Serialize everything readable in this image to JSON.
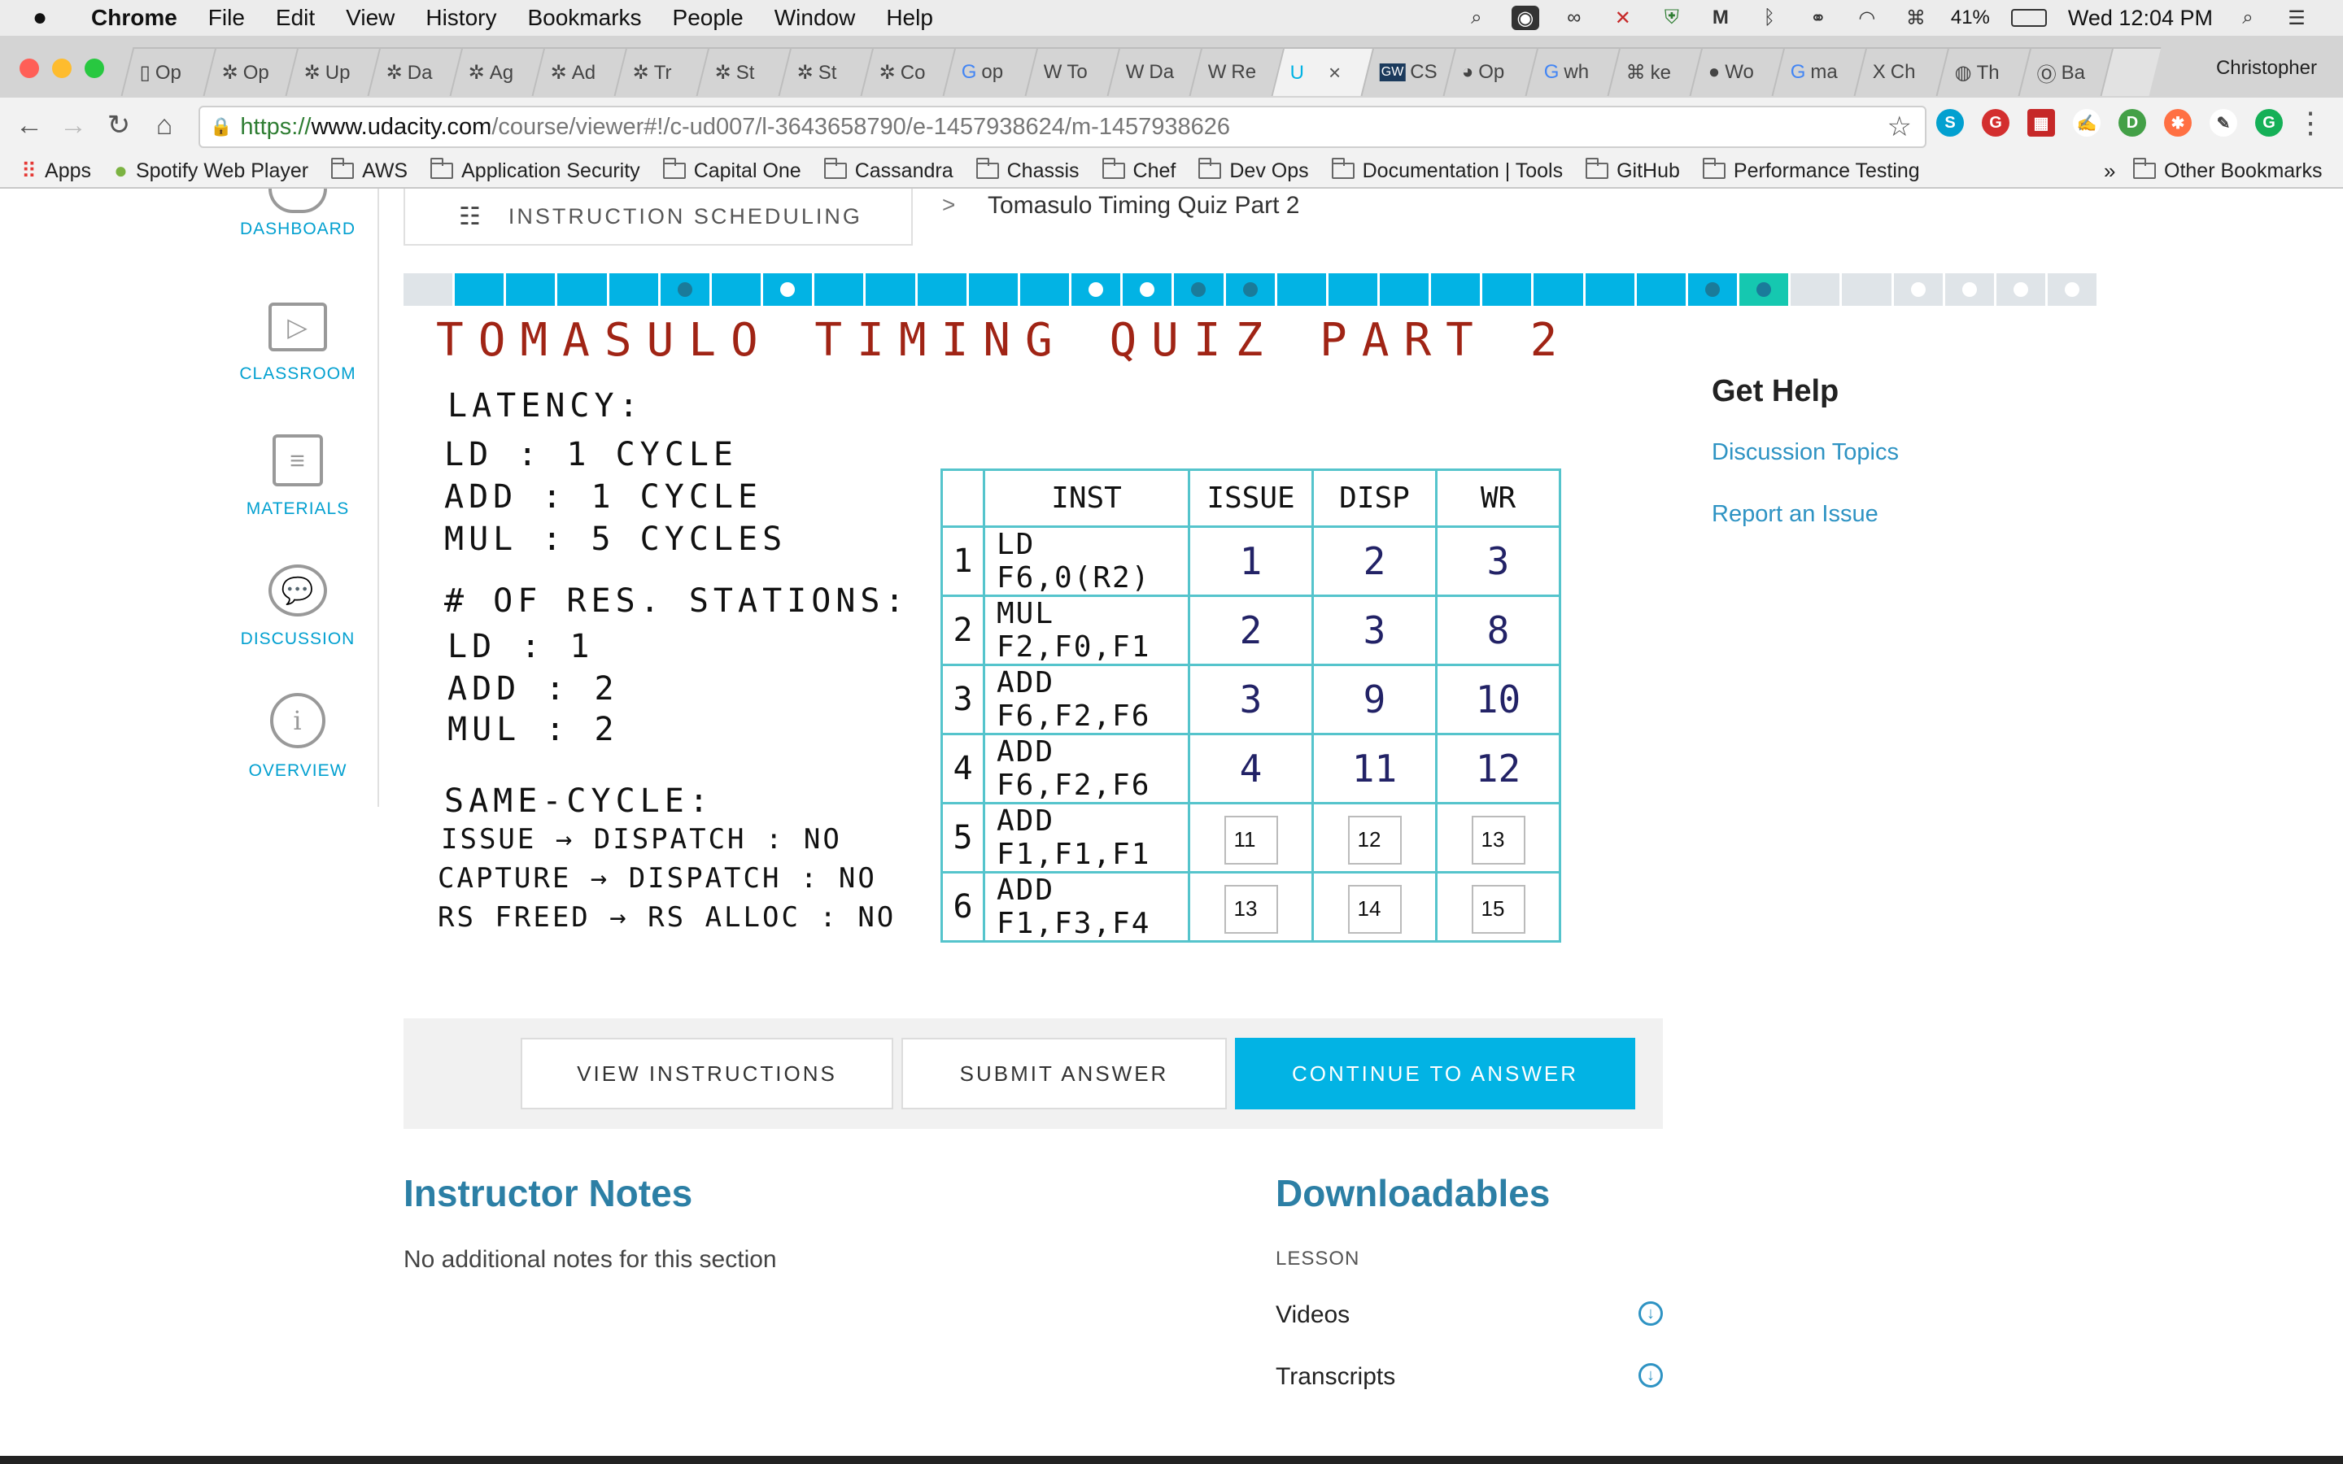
{
  "menubar": {
    "apple": "",
    "app": "Chrome",
    "items": [
      "File",
      "Edit",
      "View",
      "History",
      "Bookmarks",
      "People",
      "Window",
      "Help"
    ],
    "battery": "41%",
    "clock": "Wed 12:04 PM",
    "icons": [
      "search-icon",
      "record-icon",
      "glasses-icon",
      "tool-icon",
      "shield-icon",
      "m-icon",
      "bluetooth-icon",
      "binoculars-icon",
      "wifi-icon",
      "keyboard-icon",
      "battery-icon",
      "spotlight-icon",
      "list-icon"
    ]
  },
  "tabs": [
    {
      "label": "Op",
      "icon": "page-icon"
    },
    {
      "label": "Op",
      "icon": "spinner-icon"
    },
    {
      "label": "Up",
      "icon": "spinner-icon"
    },
    {
      "label": "Da",
      "icon": "spinner-icon"
    },
    {
      "label": "Ag",
      "icon": "spinner-icon"
    },
    {
      "label": "Ad",
      "icon": "spinner-icon"
    },
    {
      "label": "Tr",
      "icon": "spinner-icon"
    },
    {
      "label": "St",
      "icon": "spinner-icon"
    },
    {
      "label": "St",
      "icon": "spinner-icon"
    },
    {
      "label": "Co",
      "icon": "spinner-icon"
    },
    {
      "label": "op",
      "icon": "google-icon"
    },
    {
      "label": "To",
      "icon": "wikipedia-icon"
    },
    {
      "label": "Da",
      "icon": "wikipedia-icon"
    },
    {
      "label": "Re",
      "icon": "wikipedia-icon"
    },
    {
      "label": "",
      "icon": "udacity-icon",
      "active": true
    },
    {
      "label": "CS",
      "icon": "gw-icon"
    },
    {
      "label": "Op",
      "icon": "reddit-icon"
    },
    {
      "label": "wh",
      "icon": "google-icon"
    },
    {
      "label": "ke",
      "icon": "command-icon"
    },
    {
      "label": "Wo",
      "icon": "apple-icon"
    },
    {
      "label": "ma",
      "icon": "google-icon"
    },
    {
      "label": "Ch",
      "icon": "x-icon"
    },
    {
      "label": "Th",
      "icon": "globe-icon"
    },
    {
      "label": "Ba",
      "icon": "bracket-icon"
    }
  ],
  "profile": "Christopher",
  "url": {
    "scheme": "https://",
    "host": "www.udacity.com",
    "path": "/course/viewer#!/c-ud007/l-3643658790/e-1457938624/m-1457938626"
  },
  "bookmarks": [
    {
      "label": "Apps",
      "icon": "apps-icon"
    },
    {
      "label": "Spotify Web Player",
      "icon": "spotify-icon"
    },
    {
      "label": "AWS",
      "icon": "folder-icon"
    },
    {
      "label": "Application Security",
      "icon": "folder-icon"
    },
    {
      "label": "Capital One",
      "icon": "folder-icon"
    },
    {
      "label": "Cassandra",
      "icon": "folder-icon"
    },
    {
      "label": "Chassis",
      "icon": "folder-icon"
    },
    {
      "label": "Chef",
      "icon": "folder-icon"
    },
    {
      "label": "Dev Ops",
      "icon": "folder-icon"
    },
    {
      "label": "Documentation | Tools",
      "icon": "folder-icon"
    },
    {
      "label": "GitHub",
      "icon": "folder-icon"
    },
    {
      "label": "Performance Testing",
      "icon": "folder-icon"
    }
  ],
  "bookmarks_more": "»",
  "bookmarks_other": "Other Bookmarks",
  "nav": {
    "dashboard": "DASHBOARD",
    "classroom": "CLASSROOM",
    "materials": "MATERIALS",
    "discussion": "DISCUSSION",
    "overview": "OVERVIEW"
  },
  "breadcrumb": {
    "lesson": "INSTRUCTION SCHEDULING",
    "separator": ">",
    "title": "Tomasulo Timing Quiz Part 2"
  },
  "progress": {
    "segments": [
      "blank",
      "done",
      "done",
      "done",
      "done",
      "done-dark",
      "done",
      "done-white",
      "done",
      "done",
      "done",
      "done",
      "done",
      "done-white",
      "done-white",
      "done-dark",
      "done-dark",
      "done",
      "done",
      "done",
      "done",
      "done",
      "done",
      "done",
      "done",
      "done-dark",
      "current-dark",
      "blank",
      "blank",
      "blank-white",
      "blank-white",
      "blank-white",
      "blank-white"
    ]
  },
  "quiz": {
    "title": "TOMASULO   TIMING   QUIZ   PART 2",
    "latency_heading": "LATENCY:",
    "latency": [
      "LD : 1 CYCLE",
      "ADD : 1 CYCLE",
      "MUL : 5 CYCLES"
    ],
    "rs_heading": "# OF RES. STATIONS:",
    "rs": [
      "LD : 1",
      "ADD : 2",
      "MUL : 2"
    ],
    "same_cycle_heading": "SAME-CYCLE:",
    "same_cycle": [
      "ISSUE → DISPATCH : NO",
      "CAPTURE → DISPATCH : NO",
      "RS FREED → RS ALLOC : NO"
    ],
    "table_headers": [
      "",
      "INST",
      "ISSUE",
      "DISP",
      "WR"
    ],
    "rows": [
      {
        "n": "1",
        "inst": "LD F6,0(R2)",
        "issue": "1",
        "disp": "2",
        "wr": "3"
      },
      {
        "n": "2",
        "inst": "MUL F2,F0,F1",
        "issue": "2",
        "disp": "3",
        "wr": "8"
      },
      {
        "n": "3",
        "inst": "ADD F6,F2,F6",
        "issue": "3",
        "disp": "9",
        "wr": "10"
      },
      {
        "n": "4",
        "inst": "ADD F6,F2,F6",
        "issue": "4",
        "disp": "11",
        "wr": "12"
      }
    ],
    "answer_rows": [
      {
        "n": "5",
        "inst": "ADD F1,F1,F1",
        "issue": "11",
        "disp": "12",
        "wr": "13"
      },
      {
        "n": "6",
        "inst": "ADD F1,F3,F4",
        "issue": "13",
        "disp": "14",
        "wr": "15"
      }
    ]
  },
  "actions": {
    "view_instructions": "VIEW INSTRUCTIONS",
    "submit_answer": "SUBMIT ANSWER",
    "continue_to_answer": "CONTINUE TO ANSWER"
  },
  "help": {
    "title": "Get Help",
    "discussion": "Discussion Topics",
    "report": "Report an Issue"
  },
  "notes": {
    "title": "Instructor Notes",
    "text": "No additional notes for this section"
  },
  "downloads": {
    "title": "Downloadables",
    "section": "LESSON",
    "items": [
      "Videos",
      "Transcripts"
    ]
  },
  "colors": {
    "accent": "#02b3e4",
    "link": "#2e93c3",
    "heading": "#2c7fa5",
    "progress_current": "#15c8b0",
    "quiz_title": "#a02415",
    "table_lines": "#55c4cc"
  }
}
